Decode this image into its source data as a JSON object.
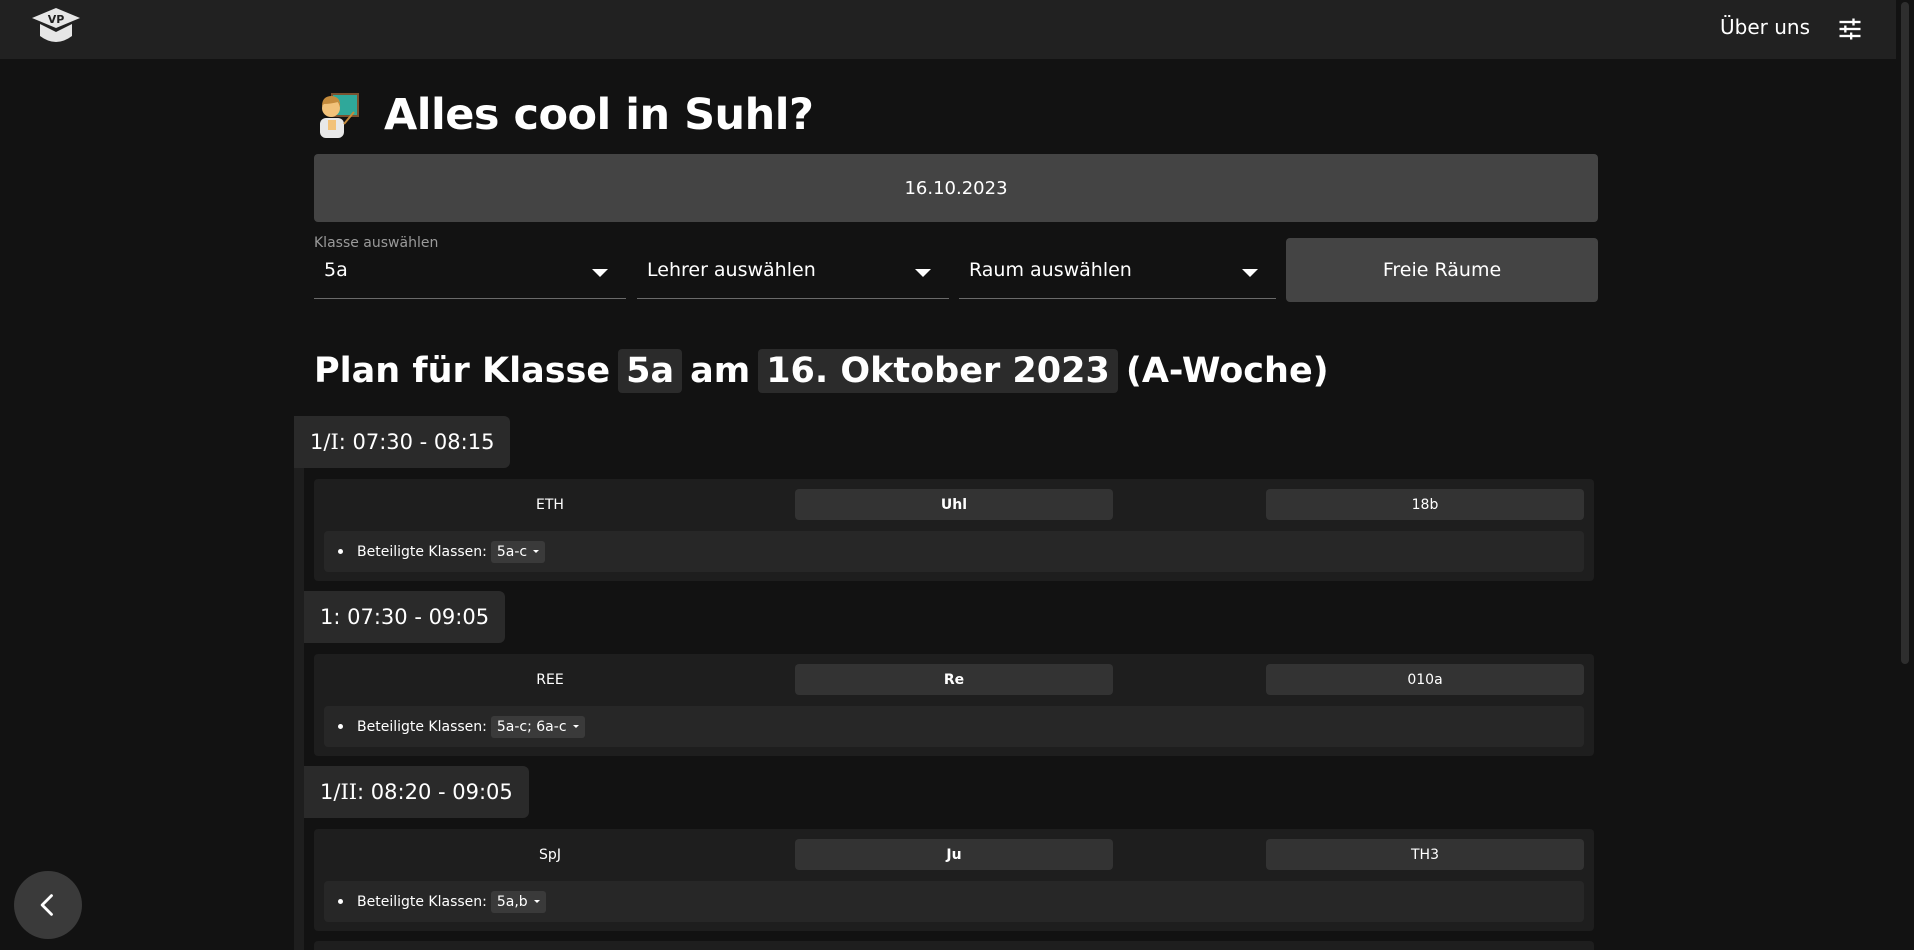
{
  "header": {
    "logo_text": "VP",
    "about_label": "Über uns",
    "settings_icon": "tune-icon"
  },
  "page": {
    "title": "Alles cool in Suhl?",
    "title_emoji": "teacher-emoji",
    "date": "16.10.2023"
  },
  "selectors": {
    "class": {
      "label": "Klasse auswählen",
      "value": "5a"
    },
    "teacher": {
      "placeholder": "Lehrer auswählen"
    },
    "room": {
      "placeholder": "Raum auswählen"
    },
    "free_rooms_label": "Freie Räume"
  },
  "plan": {
    "prefix": "Plan für Klasse",
    "class": "5a",
    "mid": "am",
    "date": "16. Oktober 2023",
    "week": "(A-Woche)"
  },
  "lessons": [
    {
      "period": "1/",
      "period_roman": "I",
      "time": ": 07:30 - 08:15",
      "subject": "ETH",
      "teacher": "Uhl",
      "room": "18b",
      "classes_label": "Beteiligte Klassen:",
      "classes": "5a-c"
    },
    {
      "period": "1",
      "period_roman": "",
      "time": ": 07:30 - 09:05",
      "subject": "REE",
      "teacher": "Re",
      "room": "010a",
      "classes_label": "Beteiligte Klassen:",
      "classes": "5a-c; 6a-c"
    },
    {
      "period": "1/",
      "period_roman": "II",
      "time": ": 08:20 - 09:05",
      "subject": "SpJ",
      "teacher": "Ju",
      "room": "TH3",
      "classes_label": "Beteiligte Klassen:",
      "classes": "5a,b"
    }
  ],
  "nav": {
    "back_icon": "chevron-left-icon"
  }
}
